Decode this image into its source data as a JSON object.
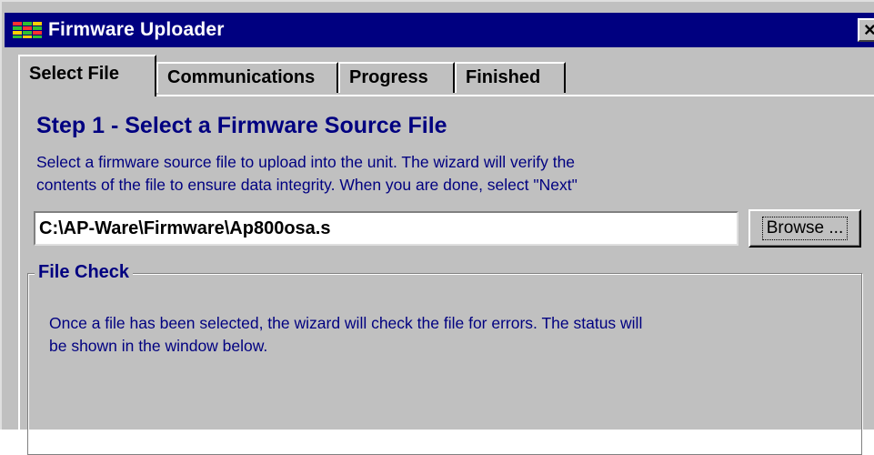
{
  "window": {
    "title": "Firmware Uploader",
    "close_label": "×",
    "icon": "app-grid-icon"
  },
  "tabs": [
    {
      "label": "Select File",
      "active": true
    },
    {
      "label": "Communications",
      "active": false
    },
    {
      "label": "Progress",
      "active": false
    },
    {
      "label": "Finished",
      "active": false
    }
  ],
  "step": {
    "title": "Step 1 - Select a Firmware Source File",
    "description_line1": "Select a firmware source file to upload into the unit.  The wizard will verify the",
    "description_line2": "contents of the file to ensure data integrity.  When you are done, select \"Next\""
  },
  "file": {
    "path": "C:\\AP-Ware\\Firmware\\Ap800osa.s",
    "browse_label": "Browse ..."
  },
  "file_check": {
    "legend": "File Check",
    "line1": "Once a file has been selected, the wizard will check the file for errors.  The status will",
    "line2": "be shown in the window below."
  },
  "colors": {
    "title_bar": "#000080",
    "text_accent": "#000080",
    "face": "#c0c0c0"
  }
}
